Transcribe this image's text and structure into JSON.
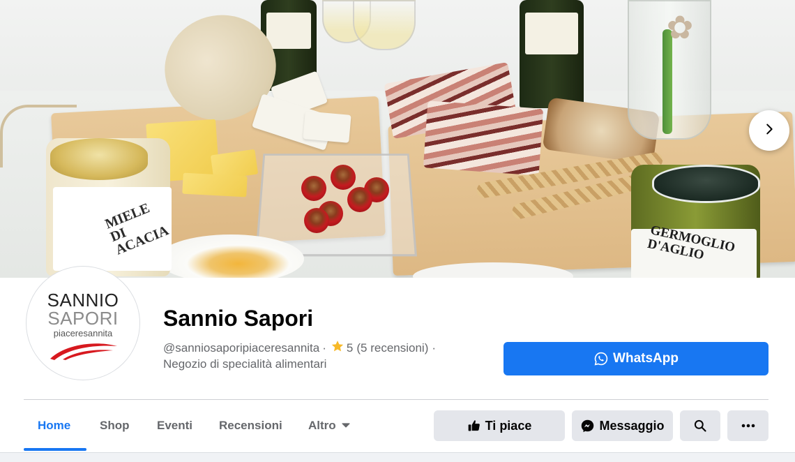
{
  "cover": {
    "honey_jar_label": "MIELE DI ACACIA",
    "garlic_jar_label": "GERMOGLIO D'AGLIO",
    "next_icon": "chevron-right-icon"
  },
  "avatar": {
    "line1": "SANNIO",
    "line2": "SAPORI",
    "line3": "piaceresannita",
    "swoosh_color": "#d7191f"
  },
  "page": {
    "name": "Sannio Sapori",
    "handle": "@sanniosaporipiaceresannita",
    "separator": "·",
    "rating": "5",
    "reviews": "(5 recensioni)",
    "category": "Negozio di specialità alimentari"
  },
  "primary_action": {
    "label": "WhatsApp",
    "icon": "whatsapp-icon",
    "color": "#1877f2"
  },
  "tabs": [
    {
      "label": "Home",
      "active": true
    },
    {
      "label": "Shop"
    },
    {
      "label": "Eventi"
    },
    {
      "label": "Recensioni"
    },
    {
      "label": "Altro",
      "icon": "caret-down-icon"
    }
  ],
  "actions": {
    "like_label": "Ti piace",
    "message_label": "Messaggio",
    "search_icon": "search-icon",
    "more_icon": "more-icon"
  },
  "colors": {
    "accent": "#1877f2",
    "secondary_button": "#e4e6eb",
    "muted_text": "#65676b",
    "star": "#f7b928"
  }
}
